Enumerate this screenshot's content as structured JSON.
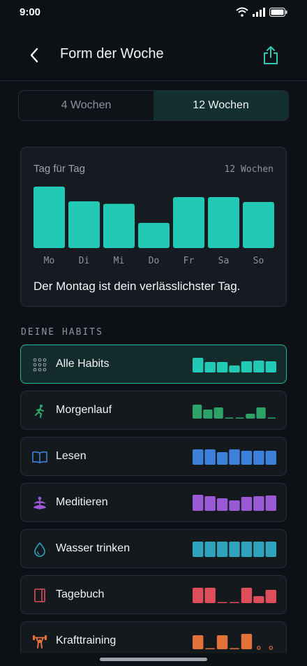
{
  "status": {
    "time": "9:00"
  },
  "header": {
    "title": "Form der Woche"
  },
  "segment": {
    "options": [
      "4 Wochen",
      "12 Wochen"
    ],
    "selected": "12 Wochen"
  },
  "weekday_card": {
    "title": "Tag für Tag",
    "range": "12 Wochen",
    "summary": "Der Montag ist dein verlässlichster Tag.",
    "accent": "#22c9b4"
  },
  "chart_data": {
    "type": "bar",
    "categories": [
      "Mo",
      "Di",
      "Mi",
      "Do",
      "Fr",
      "Sa",
      "So"
    ],
    "values": [
      1.0,
      0.76,
      0.72,
      0.41,
      0.83,
      0.83,
      0.75
    ],
    "ylim": [
      0,
      1
    ],
    "title": "Tag für Tag",
    "xlabel": "",
    "ylabel": "",
    "grid": false
  },
  "habits_section": {
    "label": "DEINE HABITS"
  },
  "habits": [
    {
      "label": "Alle Habits",
      "icon": "grid-dots-icon",
      "color": "#22c9b4",
      "active": true,
      "week": [
        0.84,
        0.6,
        0.6,
        0.4,
        0.64,
        0.68,
        0.64
      ]
    },
    {
      "label": "Morgenlauf",
      "icon": "running-person-icon",
      "color": "#2da36a",
      "active": false,
      "week": [
        0.8,
        0.52,
        0.64,
        0.0,
        0.0,
        0.28,
        0.64,
        0.0
      ]
    },
    {
      "label": "Lesen",
      "icon": "open-book-icon",
      "color": "#3e7fd9",
      "active": false,
      "week": [
        0.88,
        0.88,
        0.72,
        0.88,
        0.8,
        0.8,
        0.8
      ]
    },
    {
      "label": "Meditieren",
      "icon": "meditation-icon",
      "color": "#9a5ad6",
      "active": false,
      "week": [
        0.92,
        0.84,
        0.72,
        0.6,
        0.8,
        0.84,
        0.88
      ]
    },
    {
      "label": "Wasser trinken",
      "icon": "water-drop-icon",
      "color": "#2fa3bb",
      "active": false,
      "week": [
        0.88,
        0.88,
        0.88,
        0.88,
        0.88,
        0.88,
        0.88
      ]
    },
    {
      "label": "Tagebuch",
      "icon": "journal-icon",
      "color": "#dd4d5c",
      "active": false,
      "week": [
        0.88,
        0.88,
        0.0,
        0.0,
        0.88,
        0.4,
        0.76
      ]
    },
    {
      "label": "Krafttraining",
      "icon": "weightlifter-icon",
      "color": "#e2723a",
      "active": false,
      "week": [
        0.8,
        0.0,
        0.8,
        0.0,
        0.88,
        -1,
        -1
      ]
    }
  ]
}
